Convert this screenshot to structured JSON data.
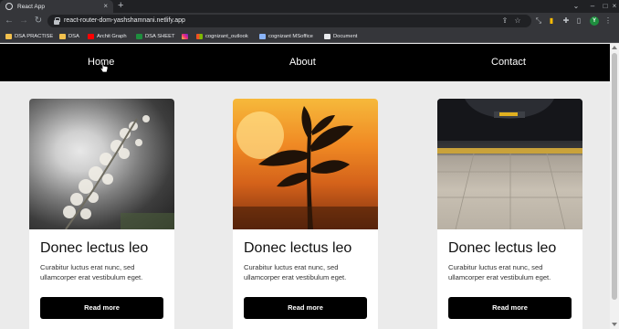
{
  "browser": {
    "tab_title": "React App",
    "tab_close": "×",
    "new_tab": "+",
    "window_controls": [
      "–",
      "□",
      "×"
    ],
    "url": "react-router-dom-yashshamnani.netlify.app",
    "avatar_letter": "Y"
  },
  "bookmarks": [
    {
      "label": "DSA PRACTISE",
      "icon": "folder-icon"
    },
    {
      "label": "DSA",
      "icon": "folder-icon"
    },
    {
      "label": "Archit Graph",
      "icon": "youtube-icon"
    },
    {
      "label": "DSA SHEET",
      "icon": "sheets-icon"
    },
    {
      "label": "",
      "icon": "instagram-icon"
    },
    {
      "label": "cognizant_outlook",
      "icon": "microsoft-icon"
    },
    {
      "label": "cognizant MSoffice",
      "icon": "globe-icon"
    },
    {
      "label": "Document",
      "icon": "document-icon"
    }
  ],
  "nav": {
    "items": [
      "Home",
      "About",
      "Contact"
    ]
  },
  "cards": [
    {
      "title": "Donec lectus leo",
      "text": "Curabitur luctus erat nunc, sed ullamcorper erat vestibulum eget.",
      "button": "Read more",
      "image": "flowers-photo"
    },
    {
      "title": "Donec lectus leo",
      "text": "Curabitur luctus erat nunc, sed ullamcorper erat vestibulum eget.",
      "button": "Read more",
      "image": "sunset-plant-photo"
    },
    {
      "title": "Donec lectus leo",
      "text": "Curabitur luctus erat nunc, sed ullamcorper erat vestibulum eget.",
      "button": "Read more",
      "image": "subway-platform-photo"
    }
  ],
  "colors": {
    "nav_bg": "#000000",
    "button_bg": "#000000",
    "page_bg": "#ebebeb"
  }
}
